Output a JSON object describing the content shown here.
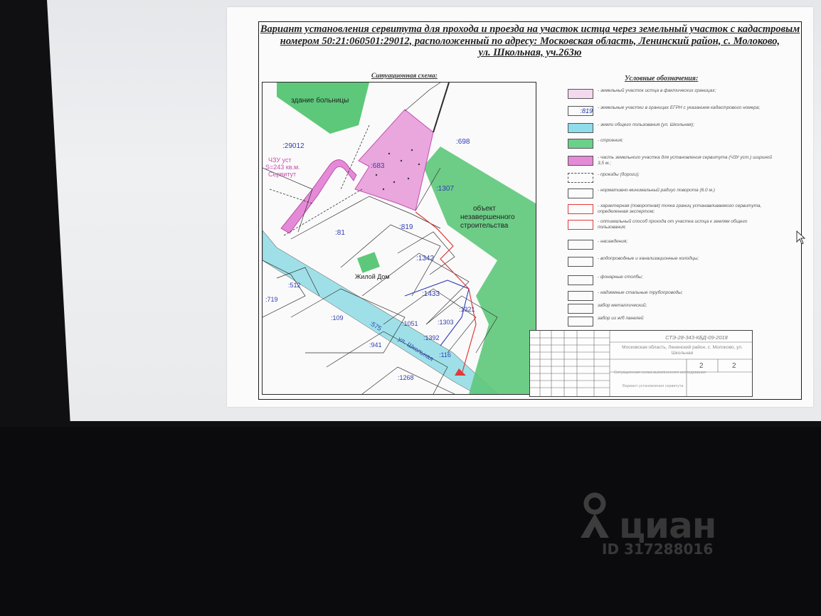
{
  "document": {
    "title_line1": "Вариант установления сервитута для прохода и проезда на участок истца через земельный участок с кадастровым",
    "title_line2": "номером 50:21:060501:29012, расположенный по адресу: Московская область, Ленинский район, с. Молоково,",
    "title_line3": "ул. Школьная, уч.263ю",
    "map_caption": "Ситуационная схема:",
    "legend_caption": "Условные обозначения:"
  },
  "map": {
    "labels": {
      "hospital": "здание больницы",
      "parcel_29012": ":29012",
      "servitude_1": "ЧЗУ уст",
      "servitude_2": "S=243 кв.м.",
      "servitude_3": "Сервитут",
      "parcel_683": ":683",
      "parcel_698": ":698",
      "parcel_1307": ":1307",
      "unfinished_1": "объект",
      "unfinished_2": "незавершенного",
      "unfinished_3": "строительства",
      "parcel_819": ":819",
      "parcel_81": ":81",
      "parcel_1342": ":1342",
      "house": "Жилой Дом",
      "parcel_1433": ":1433",
      "parcel_512": ":512",
      "parcel_719": ":719",
      "parcel_109": ":109",
      "parcel_575": ":575",
      "street": "ул. Школьная",
      "parcel_1051": ":1051",
      "parcel_1303": ":1303",
      "parcel_1321": ":1321",
      "parcel_1392": ":1392",
      "parcel_941": ":941",
      "parcel_116": ":116",
      "parcel_1268": ":1268"
    },
    "colors": {
      "green": "#5dc87a",
      "pink": "#e58ad7",
      "cyan": "#9fe0e8",
      "red": "#e03a3a",
      "blue": "#2e3fb5"
    }
  },
  "legend": {
    "items": [
      {
        "swatch": "",
        "color": "#f3d9ee",
        "text": "- земельный участок истца в фактических границах;"
      },
      {
        "swatch": ":819",
        "color": "#ffffff",
        "text": "- земельные участки в границах ЕГРН с указанием кадастрового номера;"
      },
      {
        "swatch": "",
        "color": "#8fdceb",
        "text": "- земли общего пользования (ул. Школьная);"
      },
      {
        "swatch": "",
        "color": "#6bd08a",
        "text": "- строения;"
      },
      {
        "swatch": "",
        "color": "#e58ad7",
        "text": "- часть земельного участка для установления сервитута (ЧЗУ уст.) шириной 3,5 м.;"
      },
      {
        "swatch": "",
        "color": "#ffffff",
        "text": "- проезды (дороги);"
      },
      {
        "swatch": "",
        "color": "#ffffff",
        "text": "- нормативно-минимальный радиус поворота (6.0 м.)"
      },
      {
        "swatch": "",
        "color": "#ffffff",
        "text": "- характерная (поворотная) точка границ устанавливаемого сервитута, определенная экспертом;"
      },
      {
        "swatch": "",
        "color": "#ffffff",
        "text": "- оптимальный способ прохода от участка истца к землям общего пользования;"
      },
      {
        "swatch": "",
        "color": "#ffffff",
        "text": "- насаждения;"
      },
      {
        "swatch": "",
        "color": "#ffffff",
        "text": "- водопроводные и канализационные колодцы;"
      },
      {
        "swatch": "",
        "color": "#ffffff",
        "text": "- фонарные столбы;"
      },
      {
        "swatch": "",
        "color": "#ffffff",
        "text": "- надземные стальные трубопроводы;"
      },
      {
        "swatch": "",
        "color": "#ffffff",
        "text": "забор металлический;"
      },
      {
        "swatch": "",
        "color": "#ffffff",
        "text": "забор из ж/б панелей"
      }
    ]
  },
  "stamp": {
    "code": "СТЭ-28-343-КБД-09-2018",
    "address": "Московская область, Ленинский район, с. Молоково, ул. Школьная",
    "sheet": "2",
    "sheets": "2",
    "foot1": "Ситуационная схема выполненного исследования",
    "foot2": "Вариант установления сервитута"
  },
  "watermark": {
    "brand": "циан",
    "listing_id": "ID 317288016"
  }
}
